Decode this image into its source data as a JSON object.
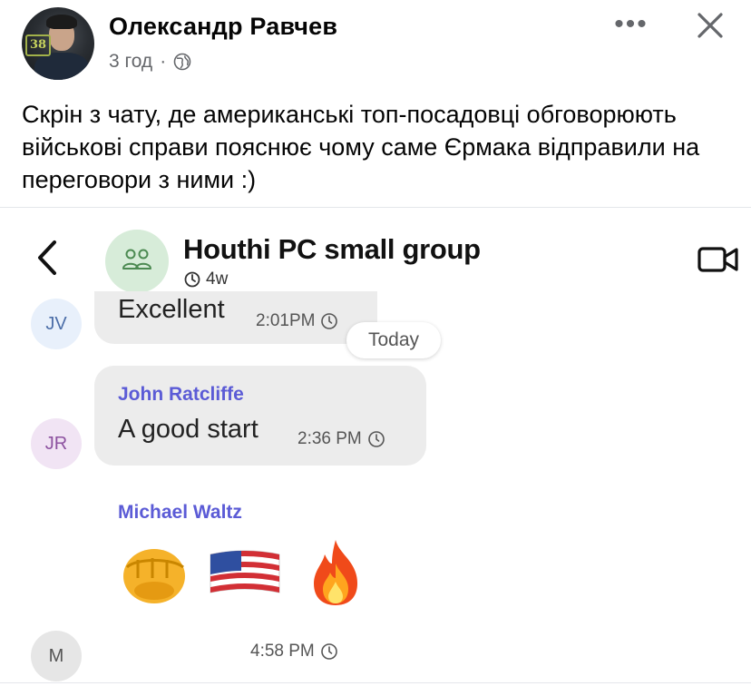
{
  "post": {
    "author": "Олександр Равчев",
    "time": "3 год",
    "separator": "·",
    "text": "Скрін з чату, де американські топ-посадовці обговорюють військові справи пояснює чому саме Єрмака відправили на переговори з ними :)",
    "avatar_badge": "38"
  },
  "chat": {
    "group_name": "Houthi PC small group",
    "group_subtitle": "4w",
    "messages": [
      {
        "initials": "JV",
        "text": "Excellent",
        "time": "2:01PM"
      },
      {
        "initials": "JR",
        "sender": "John Ratcliffe",
        "text": "A good start",
        "time": "2:36 PM"
      },
      {
        "initials": "M",
        "sender": "Michael Waltz",
        "emojis": [
          "oncoming-fist",
          "us-flag",
          "fire"
        ],
        "time": "4:58 PM"
      }
    ],
    "date_chip": "Today"
  },
  "colors": {
    "sender_name": "#5b5bd6",
    "bubble": "#ececec",
    "group_avatar_bg": "#d7ecd9",
    "meta_gray": "#65676b"
  },
  "icons": [
    "globe-icon",
    "more-icon",
    "close-icon",
    "back-icon",
    "group-icon",
    "video-call-icon",
    "clock-icon"
  ]
}
